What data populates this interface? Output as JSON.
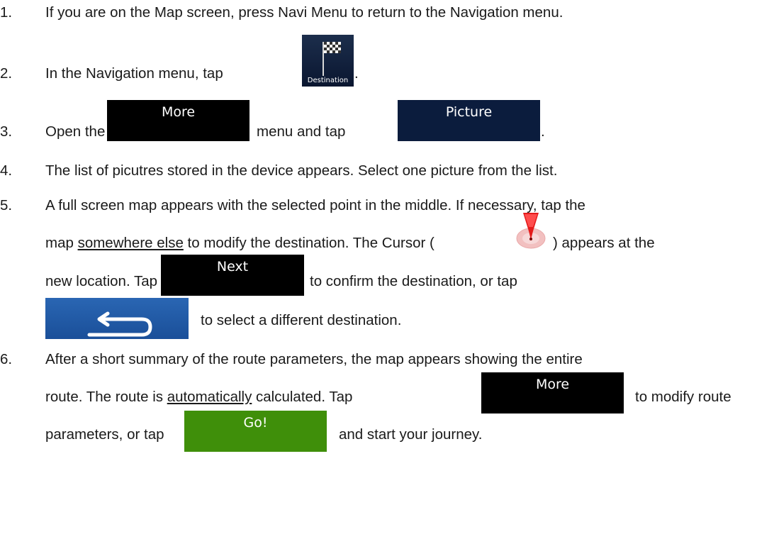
{
  "steps": [
    {
      "num": "1.",
      "text": "If you are on the Map screen, press Navi Menu to return to the Navigation menu."
    },
    {
      "num": "2.",
      "before": "In the Navigation menu, tap",
      "after": ".",
      "icon_label": "Destination",
      "icon": "checkered-flag-icon"
    },
    {
      "num": "3.",
      "before": "Open the",
      "middle": "menu and tap",
      "after": ".",
      "button1": "More",
      "button2": "Picture"
    },
    {
      "num": "4.",
      "text": "The list of picutres stored in the device appears. Select one picture from the list."
    },
    {
      "num": "5.",
      "line1": "A full screen map appears with the selected point in the middle. If necessary, tap the",
      "line2a": "map ",
      "line2b": "somewhere else",
      "line2c": " to modify the destination. The Cursor (",
      "line2d": ") appears at the",
      "line3a": "new location. Tap",
      "line3b": "to confirm the destination, or tap",
      "next_button": "Next",
      "line4": "to select a different destination.",
      "cursor_icon": "map-cursor-icon",
      "back_icon": "back-arrow-icon"
    },
    {
      "num": "6.",
      "line1": "After a short summary of the route parameters, the map appears showing the entire",
      "line2a": "route. The route is ",
      "line2b": "automatically",
      "line2c": " calculated. Tap",
      "line2d": "to modify route",
      "more_button": "More",
      "line3a": "parameters, or tap",
      "line3b": "and start your journey.",
      "go_button": "Go!"
    }
  ],
  "colors": {
    "black_button": "#000000",
    "navy_button": "#0b1c3d",
    "green_button": "#3f8f0a",
    "blue_button": "#1f5aa6",
    "cursor_red": "#e41b1b"
  }
}
